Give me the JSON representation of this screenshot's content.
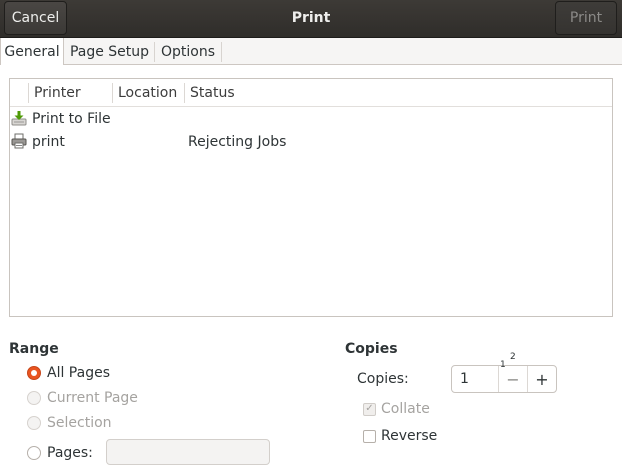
{
  "header": {
    "title": "Print",
    "cancel_label": "Cancel",
    "print_label": "Print"
  },
  "tabs": [
    {
      "label": "General",
      "active": true
    },
    {
      "label": "Page Setup",
      "active": false
    },
    {
      "label": "Options",
      "active": false
    }
  ],
  "printer_list": {
    "columns": [
      "Printer",
      "Location",
      "Status"
    ],
    "rows": [
      {
        "name": "Print to File",
        "location": "",
        "status": "",
        "icon": "save-file-icon"
      },
      {
        "name": "print",
        "location": "",
        "status": "Rejecting Jobs",
        "icon": "printer-icon"
      }
    ]
  },
  "range": {
    "title": "Range",
    "options": [
      {
        "label": "All Pages",
        "checked": true,
        "disabled": false
      },
      {
        "label": "Current Page",
        "checked": false,
        "disabled": true
      },
      {
        "label": "Selection",
        "checked": false,
        "disabled": true
      },
      {
        "label": "Pages:",
        "checked": false,
        "disabled": false
      }
    ],
    "pages_value": ""
  },
  "copies": {
    "title": "Copies",
    "label": "Copies:",
    "value": "1",
    "minus": "−",
    "plus": "+",
    "collate_label": "Collate",
    "collate_checked": true,
    "collate_disabled": true,
    "reverse_label": "Reverse",
    "reverse_checked": false,
    "preview_page_1": "1",
    "preview_page_2": "2"
  },
  "colors": {
    "accent": "#e95420",
    "header_bg": "#2f2d2a"
  }
}
